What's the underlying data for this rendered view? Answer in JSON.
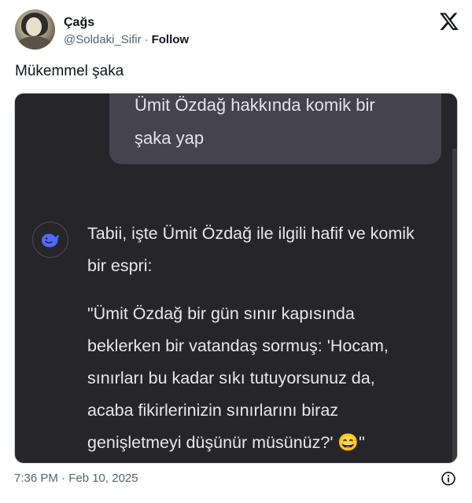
{
  "author": {
    "name": "Çağs",
    "handle": "@Soldaki_Sifir",
    "separator": "·",
    "follow_label": "Follow"
  },
  "tweet": {
    "text": "Mükemmel şaka",
    "timestamp": "7:36 PM · Feb 10, 2025"
  },
  "media": {
    "user_message_lines": [
      "Ümit Özdağ hakkında komik bir",
      "şaka yap"
    ],
    "response_lines": [
      "Tabii, işte Ümit Özdağ ile ilgili hafif ve komik",
      "bir espri:",
      "\"Ümit Özdağ bir gün sınır kapısında",
      "beklerken bir vatandaş sormuş: 'Hocam,",
      "sınırları bu kadar sıkı tutuyorsunuz da,",
      "acaba fikirlerinizin sınırlarını biraz",
      "genişletmeyi düşünür müsünüz?' 😄\""
    ]
  },
  "colors": {
    "media_bg": "#26262a",
    "bubble_bg": "#45434f",
    "bot_icon_accent": "#4d6bfe",
    "secondary_text": "#536471"
  },
  "icons": {
    "platform": "x-logo-icon",
    "bot": "deepseek-whale-icon",
    "info": "info-icon"
  }
}
